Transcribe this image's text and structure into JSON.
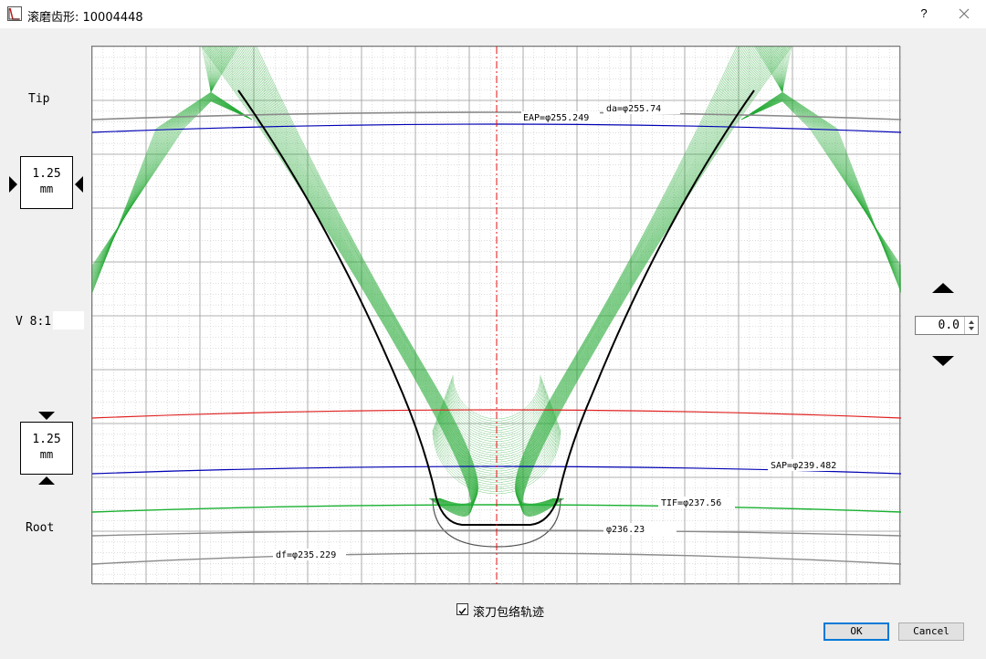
{
  "window": {
    "title": "滚磨齿形: 10004448",
    "help": "?"
  },
  "labels": {
    "tip": "Tip",
    "root": "Root",
    "scale": "V 8:1",
    "top_spin_value": "1.25",
    "top_spin_unit": "mm",
    "bottom_spin_value": "1.25",
    "bottom_spin_unit": "mm",
    "offset_value": "0.0"
  },
  "plot": {
    "annotations": {
      "da": "da=φ255.74",
      "eap": "EAP=φ255.249",
      "sap": "SAP=φ239.482",
      "tif": "TIF=φ237.56",
      "d236": "φ236.23",
      "df": "df=φ235.229"
    },
    "colors": {
      "envelope": "#22a832",
      "eap_sap": "#0000b4",
      "reference": "#e02020",
      "tif": "#18b030",
      "circles": "#8a8a8a",
      "profile": "#000000",
      "centerline": "#e01010"
    }
  },
  "options": {
    "envelope_label": "滚刀包络轨迹",
    "envelope_checked": true
  },
  "buttons": {
    "ok": "OK",
    "cancel": "Cancel"
  }
}
